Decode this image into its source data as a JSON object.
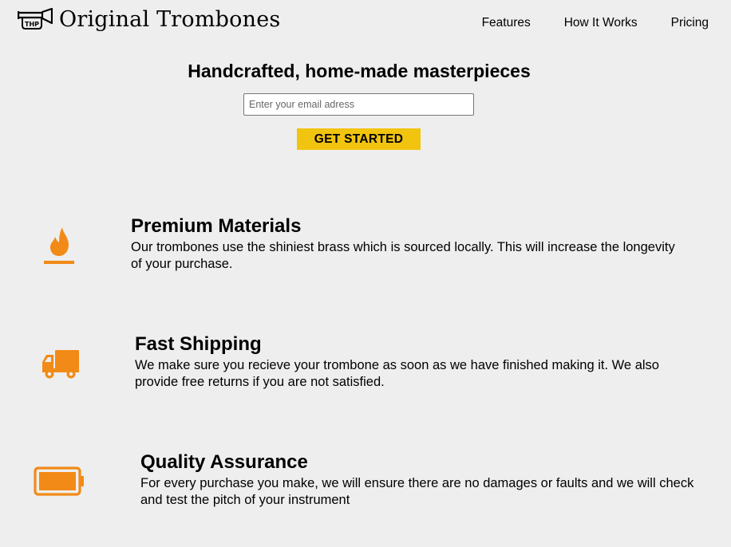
{
  "brand": {
    "name": "Original Trombones",
    "logo_icon": "trombone-logo-icon",
    "logo_letters": "THP"
  },
  "nav": {
    "items": [
      {
        "label": "Features"
      },
      {
        "label": "How It Works"
      },
      {
        "label": "Pricing"
      }
    ]
  },
  "hero": {
    "title": "Handcrafted, home-made masterpieces",
    "email_placeholder": "Enter your email adress",
    "email_value": "",
    "cta_label": "GET STARTED"
  },
  "features": [
    {
      "icon": "fire-icon",
      "title": "Premium Materials",
      "text": "Our trombones use the shiniest brass which is sourced locally. This will increase the longevity of your purchase."
    },
    {
      "icon": "truck-icon",
      "title": "Fast Shipping",
      "text": "We make sure you recieve your trombone as soon as we have finished making it. We also provide free returns if you are not satisfied."
    },
    {
      "icon": "battery-full-icon",
      "title": "Quality Assurance",
      "text": "For every purchase you make, we will ensure there are no damages or faults and we will check and test the pitch of your instrument"
    }
  ],
  "colors": {
    "background": "#eeeeee",
    "accent_yellow": "#f1c40f",
    "icon_orange": "#f28a17"
  }
}
